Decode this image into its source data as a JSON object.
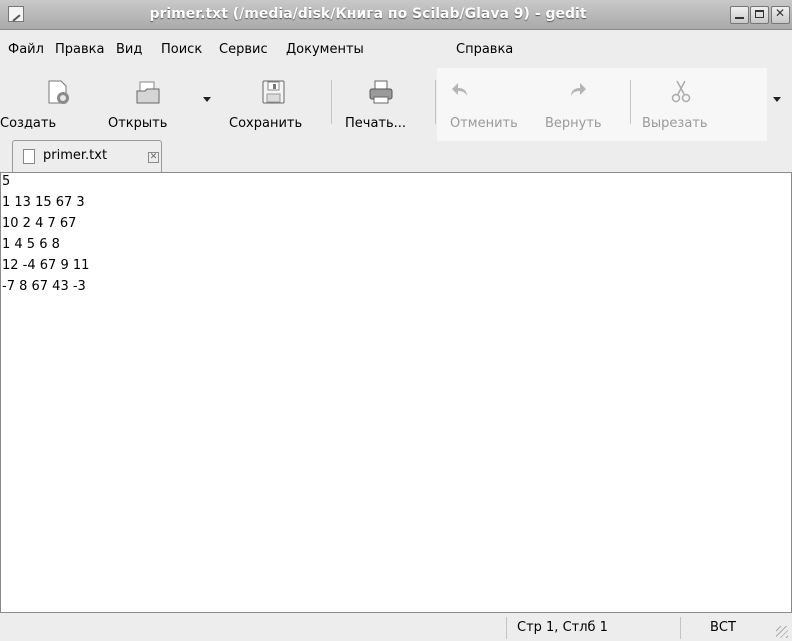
{
  "window": {
    "title": "primer.txt (/media/disk/Книга по Scilab/Glava 9) - gedit"
  },
  "menu": {
    "items": [
      {
        "label": "Файл"
      },
      {
        "label": "Правка"
      },
      {
        "label": "Вид"
      },
      {
        "label": "Поиск"
      },
      {
        "label": "Сервис"
      },
      {
        "label": "Документы"
      },
      {
        "label": "Справка"
      }
    ]
  },
  "toolbar": {
    "new_label": "Создать",
    "open_label": "Открыть",
    "save_label": "Сохранить",
    "print_label": "Печать...",
    "undo_label": "Отменить",
    "redo_label": "Вернуть",
    "cut_label": "Вырезать"
  },
  "tabs": [
    {
      "label": "primer.txt"
    }
  ],
  "editor": {
    "lines": [
      "5",
      "1 13 15 67 3",
      "10 2 4 7 67",
      "1 4 5 6 8",
      "12 -4 67 9 11",
      "-7 8 67 43 -3"
    ]
  },
  "status": {
    "position": "Стр 1, Стлб 1",
    "mode": "ВСТ"
  }
}
